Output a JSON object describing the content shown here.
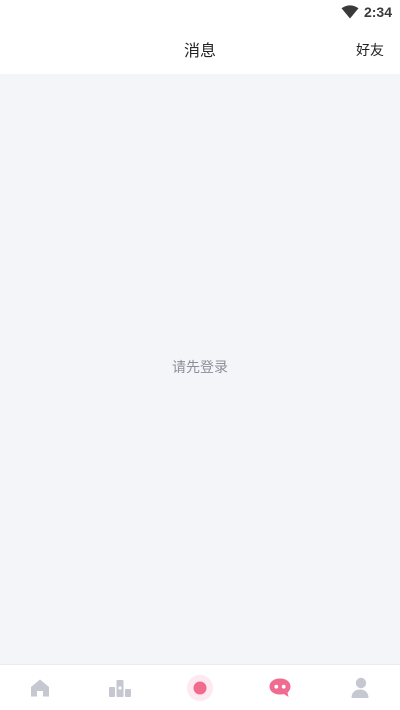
{
  "status_bar": {
    "time": "2:34",
    "wifi_icon": "wifi-icon"
  },
  "header": {
    "title": "消息",
    "right_action": "好友"
  },
  "content": {
    "empty_prompt": "请先登录"
  },
  "tabbar": {
    "active_color": "#f06b8f",
    "inactive_color": "#c5c8d1",
    "active_tab": "messages",
    "tabs": [
      {
        "id": "home",
        "icon": "home-icon"
      },
      {
        "id": "ranking",
        "icon": "podium-icon"
      },
      {
        "id": "center",
        "icon": "dot-icon"
      },
      {
        "id": "messages",
        "icon": "chat-bubble-icon"
      },
      {
        "id": "profile",
        "icon": "user-icon"
      }
    ]
  }
}
